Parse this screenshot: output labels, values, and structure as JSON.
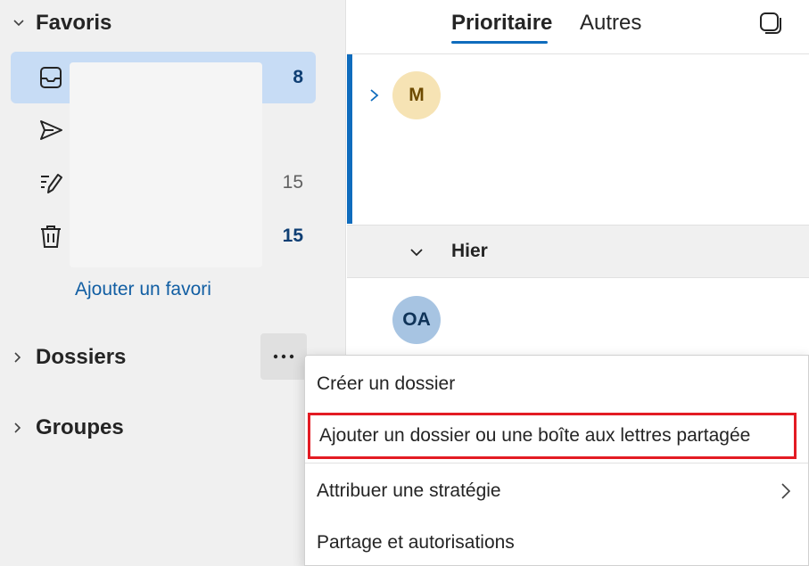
{
  "sidebar": {
    "favorites_label": "Favoris",
    "favorites": [
      {
        "icon": "inbox-icon",
        "count": "8",
        "selected": true
      },
      {
        "icon": "send-icon",
        "count": ""
      },
      {
        "icon": "drafts-icon",
        "count": "15"
      },
      {
        "icon": "trash-icon",
        "count": "15"
      }
    ],
    "add_favorite": "Ajouter un favori",
    "folders_label": "Dossiers",
    "more_label": "···",
    "groups_label": "Groupes"
  },
  "header": {
    "tabs": [
      {
        "label": "Prioritaire",
        "active": true
      },
      {
        "label": "Autres",
        "active": false
      }
    ]
  },
  "messages": {
    "items": [
      {
        "initials": "M",
        "avatar_color": "#f6e3b4"
      },
      {
        "initials": "OA",
        "avatar_color": "#a7c4e2"
      }
    ],
    "group_label": "Hier"
  },
  "context_menu": {
    "items": [
      {
        "label": "Créer un dossier"
      },
      {
        "label": "Ajouter un dossier ou une boîte aux lettres partagée",
        "highlighted": true
      },
      {
        "label": "Attribuer une stratégie",
        "has_submenu": true
      },
      {
        "label": "Partage et autorisations"
      }
    ]
  },
  "colors": {
    "accent": "#0f6cbd",
    "highlight_border": "#e31b23",
    "selected_bg": "#c7dcf5"
  }
}
